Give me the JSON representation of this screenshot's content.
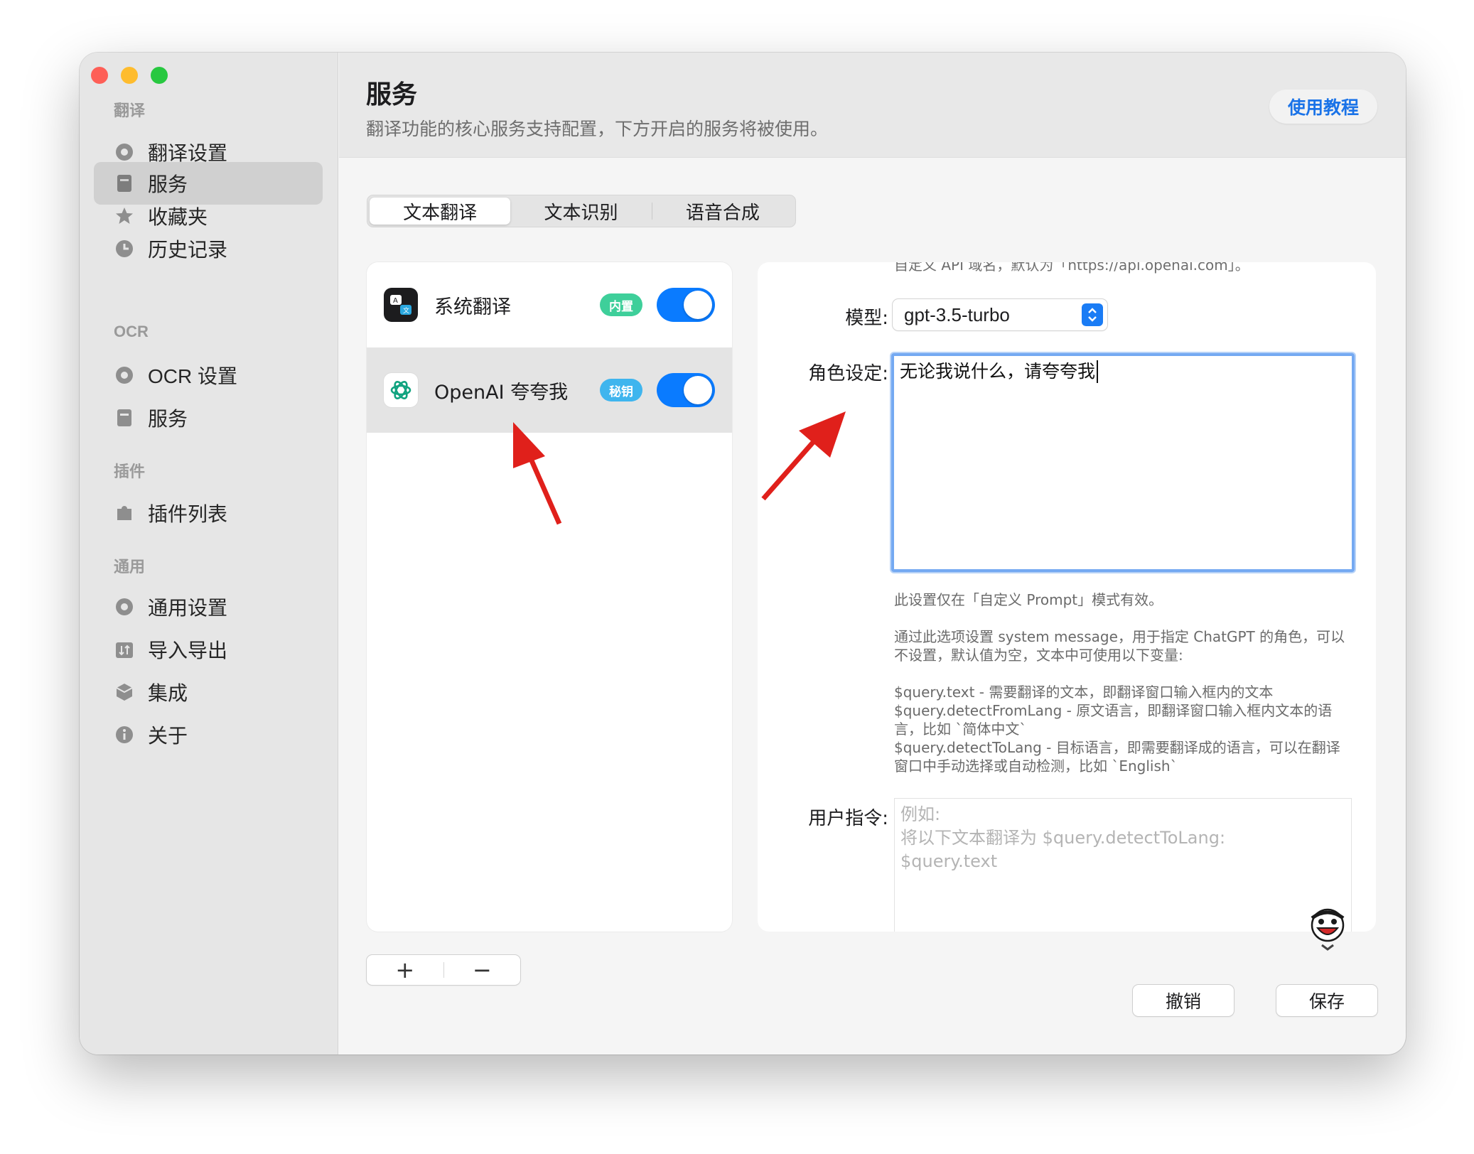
{
  "sidebar": {
    "sections": [
      {
        "title": "翻译",
        "items": [
          {
            "label": "翻译设置",
            "icon": "gear-icon"
          },
          {
            "label": "服务",
            "icon": "bookmark-icon",
            "active": true
          },
          {
            "label": "收藏夹",
            "icon": "star-icon"
          },
          {
            "label": "历史记录",
            "icon": "clock-icon"
          }
        ]
      },
      {
        "title": "OCR",
        "items": [
          {
            "label": "OCR 设置",
            "icon": "gear-icon"
          },
          {
            "label": "服务",
            "icon": "bookmark-icon"
          }
        ]
      },
      {
        "title": "插件",
        "items": [
          {
            "label": "插件列表",
            "icon": "puzzle-icon"
          }
        ]
      },
      {
        "title": "通用",
        "items": [
          {
            "label": "通用设置",
            "icon": "gear-icon"
          },
          {
            "label": "导入导出",
            "icon": "import-export-icon"
          },
          {
            "label": "集成",
            "icon": "cube-icon"
          },
          {
            "label": "关于",
            "icon": "info-icon"
          }
        ]
      }
    ]
  },
  "header": {
    "title": "服务",
    "subtitle": "翻译功能的核心服务支持配置，下方开启的服务将被使用。",
    "tutorial_label": "使用教程"
  },
  "tabs": [
    {
      "label": "文本翻译",
      "active": true
    },
    {
      "label": "文本识别"
    },
    {
      "label": "语音合成"
    }
  ],
  "services": [
    {
      "name": "系统翻译",
      "badge": "内置",
      "badge_color": "#3ecf9a",
      "enabled": true
    },
    {
      "name": "OpenAI 夸夸我",
      "badge": "秘钥",
      "badge_color": "#3fb5ee",
      "enabled": true,
      "selected": true
    }
  ],
  "list_controls": {
    "add": "+",
    "remove": "−"
  },
  "config": {
    "top_hint": "自定义 API 域名，默认为「https://api.openai.com」。",
    "model_label": "模型:",
    "model_value": "gpt-3.5-turbo",
    "role_label": "角色设定:",
    "role_value": "无论我说什么，请夸夸我",
    "help_1": "此设置仅在「自定义 Prompt」模式有效。",
    "help_2": "通过此选项设置 system message，用于指定 ChatGPT 的角色，可以不设置，默认值为空，文本中可使用以下变量:",
    "help_vars": [
      "$query.text - 需要翻译的文本，即翻译窗口输入框内的文本",
      "$query.detectFromLang - 原文语言，即翻译窗口输入框内文本的语言，比如 `简体中文`",
      "$query.detectToLang - 目标语言，即需要翻译成的语言，可以在翻译窗口中手动选择或自动检测，比如 `English`"
    ],
    "user_label": "用户指令:",
    "user_placeholder": [
      "例如:",
      "将以下文本翻译为 $query.detectToLang:",
      "$query.text"
    ]
  },
  "footer": {
    "cancel": "撤销",
    "save": "保存"
  },
  "colors": {
    "accent": "#0a7bff",
    "arrow": "#e0201b"
  }
}
